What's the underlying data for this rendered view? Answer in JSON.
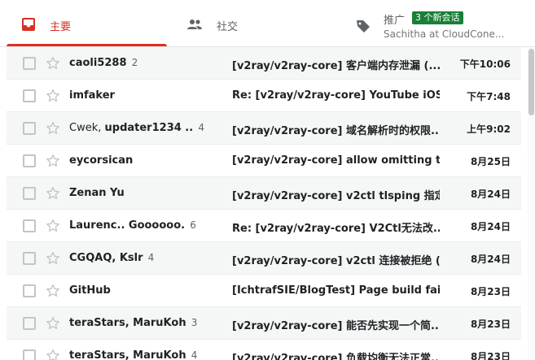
{
  "tabs": {
    "primary": {
      "label": "主要",
      "icon": "inbox-icon"
    },
    "social": {
      "label": "社交",
      "icon": "people-icon"
    },
    "promotions": {
      "label": "推广",
      "icon": "tag-icon",
      "badge": "3 个新会话",
      "subtitle": "Sachitha at CloudCone..."
    }
  },
  "colors": {
    "accent": "#d93025",
    "badge": "#188038"
  },
  "emails": [
    {
      "sender_parts": [
        {
          "text": "caoli5288",
          "bold": true
        }
      ],
      "count": "2",
      "subject": "[v2ray/v2ray-core] 客户端内存泄漏 (...",
      "date": "下午10:06"
    },
    {
      "sender_parts": [
        {
          "text": "imfaker",
          "bold": true
        }
      ],
      "count": "",
      "subject": "Re: [v2ray/v2ray-core] YouTube iOS...",
      "date": "下午7:48"
    },
    {
      "sender_parts": [
        {
          "text": "Cwek",
          "bold": false
        },
        {
          "text": ", ",
          "bold": false
        },
        {
          "text": "updater1234 ..",
          "bold": true
        }
      ],
      "count": "4",
      "subject": "[v2ray/v2ray-core] 域名解析时的权限...",
      "date": "上午9:02"
    },
    {
      "sender_parts": [
        {
          "text": "eycorsican",
          "bold": true
        }
      ],
      "count": "",
      "subject": "[v2ray/v2ray-core] allow omitting ty...",
      "date": "8月25日"
    },
    {
      "sender_parts": [
        {
          "text": "Zenan Yu",
          "bold": true
        }
      ],
      "count": "",
      "subject": "[v2ray/v2ray-core] v2ctl tlsping 指定 ...",
      "date": "8月24日"
    },
    {
      "sender_parts": [
        {
          "text": "Laurenc.. Goooooo.",
          "bold": true
        }
      ],
      "count": "6",
      "subject": "Re: [v2ray/v2ray-core] V2Ctl无法改...",
      "date": "8月24日"
    },
    {
      "sender_parts": [
        {
          "text": "CGQAQ, Kslr",
          "bold": true
        }
      ],
      "count": "4",
      "subject": "[v2ray/v2ray-core] v2ctl 连接被拒绝 (...",
      "date": "8月24日"
    },
    {
      "sender_parts": [
        {
          "text": "GitHub",
          "bold": true
        }
      ],
      "count": "",
      "subject": "[IchtrafSIE/BlogTest] Page build fail...",
      "date": "8月23日"
    },
    {
      "sender_parts": [
        {
          "text": "teraStars, MaruKoh",
          "bold": true
        }
      ],
      "count": "3",
      "subject": "[v2ray/v2ray-core] 能否先实现一个简...",
      "date": "8月23日"
    },
    {
      "sender_parts": [
        {
          "text": "teraStars, MaruKoh",
          "bold": true
        }
      ],
      "count": "4",
      "subject": "[v2ray/v2ray-core] 负载均衡无法正常...",
      "date": "8月23日"
    }
  ]
}
